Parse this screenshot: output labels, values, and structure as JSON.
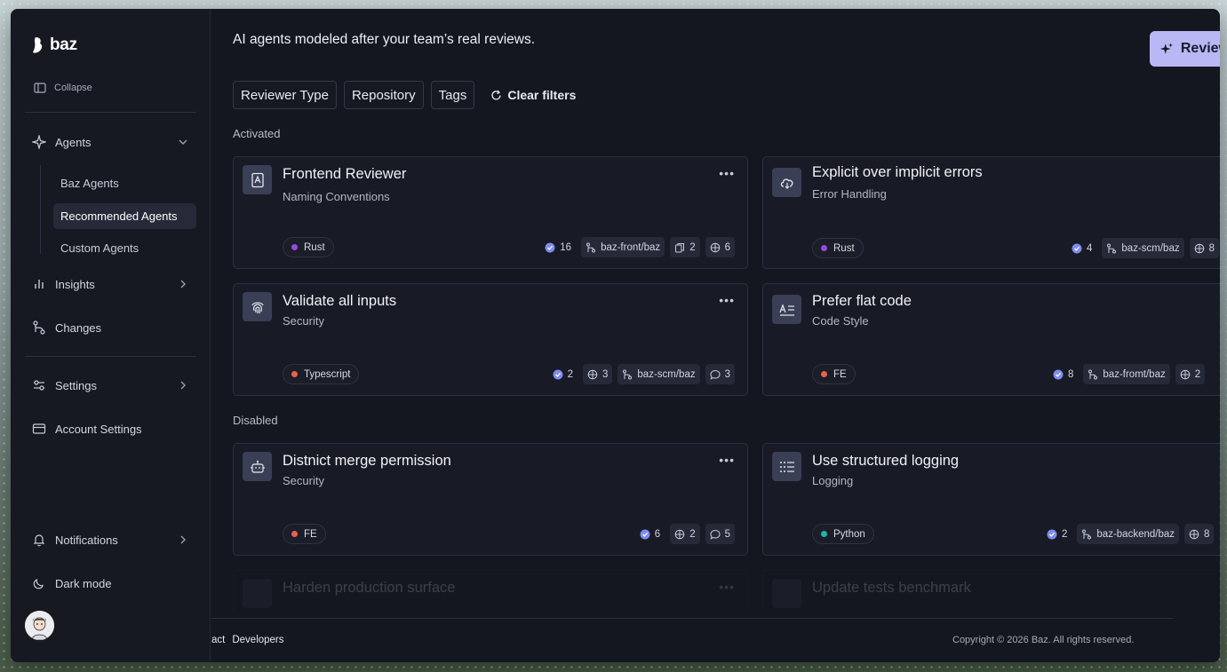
{
  "app": {
    "logo_text": "baz"
  },
  "sidebar": {
    "collapse_label": "Collapse",
    "agents_label": "Agents",
    "agents_sub": [
      "Baz Agents",
      "Recommended Agents",
      "Custom Agents"
    ],
    "insights_label": "Insights",
    "changes_label": "Changes",
    "settings_label": "Settings",
    "account_label": "Account Settings",
    "notifications_label": "Notifications",
    "darkmode_label": "Dark mode"
  },
  "main": {
    "headline": "AI agents modeled after your team’s real reviews.",
    "review_button": "Review",
    "filters": [
      "Reviewer Type",
      "Repository",
      "Tags"
    ],
    "clear_filters": "Clear filters",
    "activated_label": "Activated",
    "disabled_label": "Disabled"
  },
  "cards": [
    {
      "title": "Frontend Reviewer",
      "subtitle": "Naming Conventions",
      "lang": "Rust",
      "lang_color": "#8f4ce0",
      "approved": "16",
      "repo": "baz-front/baz",
      "copies": "2",
      "bugs": "6"
    },
    {
      "title": "Explicit over implicit errors",
      "subtitle": "Error Handling",
      "lang": "Rust",
      "lang_color": "#8f4ce0",
      "approved": "4",
      "repo": "baz-scm/baz",
      "bugs": "8"
    },
    {
      "title": "Validate all inputs",
      "subtitle": "Security",
      "lang": "Typescript",
      "lang_color": "#e5634a",
      "approved": "2",
      "bugs": "3",
      "repo": "baz-scm/baz",
      "comments": "3"
    },
    {
      "title": "Prefer flat code",
      "subtitle": "Code Style",
      "lang": "FE",
      "lang_color": "#e5634a",
      "approved": "8",
      "repo": "baz-fromt/baz",
      "bugs": "2"
    },
    {
      "title": "Distnict merge permission",
      "subtitle": "Security",
      "lang": "FE",
      "lang_color": "#e5634a",
      "approved": "6",
      "bugs": "2",
      "comments": "5"
    },
    {
      "title": "Use structured logging",
      "subtitle": "Logging",
      "lang": "Python",
      "lang_color": "#1fb5a8",
      "approved": "2",
      "repo": "baz-backend/baz",
      "bugs": "8"
    },
    {
      "title": "Harden production surface"
    },
    {
      "title": "Update tests benchmark"
    }
  ],
  "footer": {
    "links": [
      "act",
      "Developers"
    ],
    "copyright": "Copyright © 2026 Baz. All rights reserved."
  },
  "icons": [
    "baz-logo-icon",
    "sidebar-collapse-icon",
    "sparkle-icon",
    "chevron-down-icon",
    "bar-chart-icon",
    "git-branch-icon",
    "sliders-icon",
    "credit-card-icon",
    "bell-icon",
    "moon-icon",
    "refresh-icon",
    "check-badge-icon",
    "bug-icon",
    "copy-icon",
    "comment-icon",
    "ellipsis-icon",
    "file-icon",
    "cloud-icon",
    "fingerprint-icon",
    "text-align-icon",
    "robot-icon",
    "list-icon"
  ]
}
